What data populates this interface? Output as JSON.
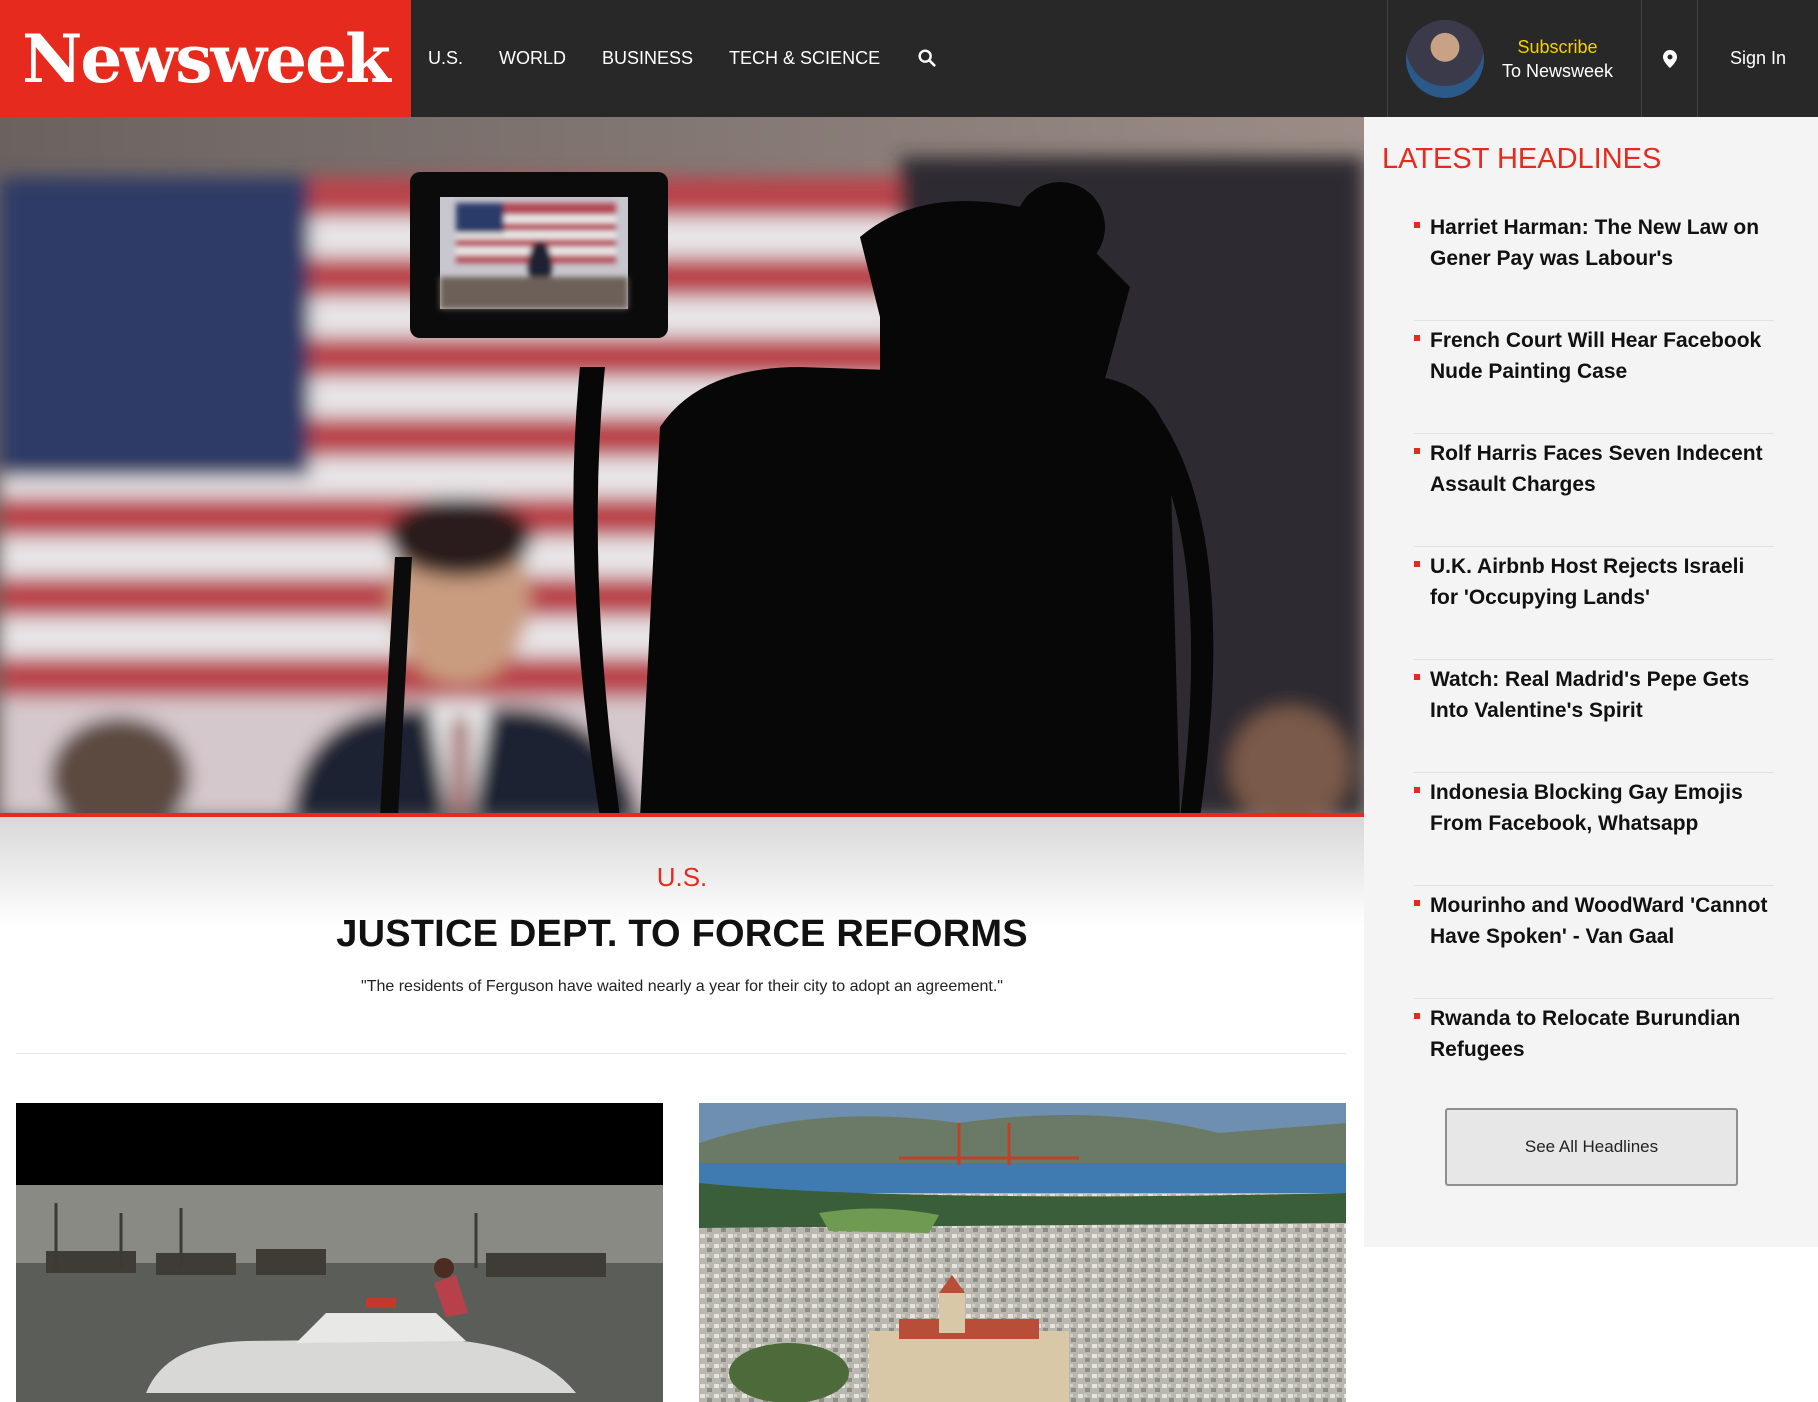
{
  "brand": {
    "name": "Newsweek",
    "accent": "#e62b1e",
    "header_bg": "#282828"
  },
  "nav": {
    "items": [
      "U.S.",
      "WORLD",
      "BUSINESS",
      "TECH & SCIENCE"
    ],
    "search_icon": "search-icon"
  },
  "subscribe": {
    "line1": "Subscribe",
    "line2": "To Newsweek"
  },
  "location_icon": "map-pin-icon",
  "signin": "Sign In",
  "hero": {
    "section": "U.S.",
    "title": "JUSTICE DEPT. TO FORCE REFORMS",
    "subtitle": "\"The residents of Ferguson have waited nearly a year for their city to adopt an agreement.\""
  },
  "sidebar": {
    "title": "LATEST HEADLINES",
    "headlines": [
      "Harriet Harman: The New Law on Gener Pay was Labour's",
      "French Court Will Hear Facebook Nude Painting Case",
      "Rolf Harris Faces Seven Indecent Assault Charges",
      "U.K. Airbnb Host Rejects Israeli for 'Occupying Lands'",
      "Watch: Real Madrid's Pepe Gets Into Valentine's Spirit",
      "Indonesia Blocking Gay Emojis From Facebook, Whatsapp",
      "Mourinho and WoodWard 'Cannot Have Spoken' - Van Gaal",
      "Rwanda to Relocate Burundian Refugees"
    ],
    "see_all": "See All Headlines"
  }
}
